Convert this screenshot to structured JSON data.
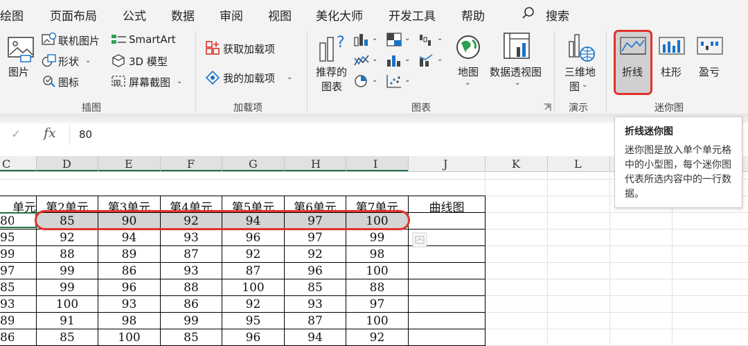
{
  "menu": {
    "items": [
      "绘图",
      "页面布局",
      "公式",
      "数据",
      "审阅",
      "视图",
      "美化大师",
      "开发工具",
      "帮助"
    ],
    "search_label": "搜索"
  },
  "ribbon": {
    "illustrations": {
      "picture": "图片",
      "online_picture": "联机图片",
      "shapes": "形状",
      "icons": "图标",
      "smartart": "SmartArt",
      "model3d": "3D 模型",
      "screenshot": "屏幕截图",
      "group": "插图"
    },
    "addins": {
      "get": "获取加载项",
      "mine": "我的加载项",
      "group": "加载项"
    },
    "charts": {
      "recommended_1": "推荐的",
      "recommended_2": "图表",
      "map": "地图",
      "pivot_chart": "数据透视图",
      "group": "图表"
    },
    "tours": {
      "map3d_1": "三维地",
      "map3d_2": "图",
      "group": "演示"
    },
    "sparklines": {
      "line": "折线",
      "column": "柱形",
      "winloss": "盈亏",
      "group": "迷你图"
    }
  },
  "formula_bar": {
    "value": "80"
  },
  "tooltip": {
    "title": "折线迷你图",
    "body": "迷你图是放入单个单元格中的小型图，每个迷你图代表所选内容中的一行数据。"
  },
  "columns": [
    "C",
    "D",
    "E",
    "F",
    "G",
    "H",
    "I",
    "J",
    "K",
    "L"
  ],
  "table": {
    "headers": [
      "单元",
      "第2单元",
      "第3单元",
      "第4单元",
      "第5单元",
      "第6单元",
      "第7单元",
      "曲线图"
    ],
    "rows": [
      [
        "80",
        "85",
        "90",
        "92",
        "94",
        "97",
        "100"
      ],
      [
        "95",
        "92",
        "94",
        "93",
        "96",
        "97",
        "99"
      ],
      [
        "99",
        "88",
        "89",
        "87",
        "92",
        "92",
        "98"
      ],
      [
        "97",
        "99",
        "86",
        "93",
        "87",
        "96",
        "100"
      ],
      [
        "85",
        "99",
        "96",
        "88",
        "100",
        "85",
        "88"
      ],
      [
        "93",
        "100",
        "93",
        "86",
        "92",
        "93",
        "97"
      ],
      [
        "89",
        "91",
        "98",
        "99",
        "95",
        "87",
        "100"
      ],
      [
        "86",
        "85",
        "100",
        "85",
        "96",
        "94",
        "92"
      ]
    ]
  },
  "colors": {
    "highlight_red": "#e0322c",
    "excel_green": "#217346",
    "selected_gray": "#d4d4d4"
  }
}
